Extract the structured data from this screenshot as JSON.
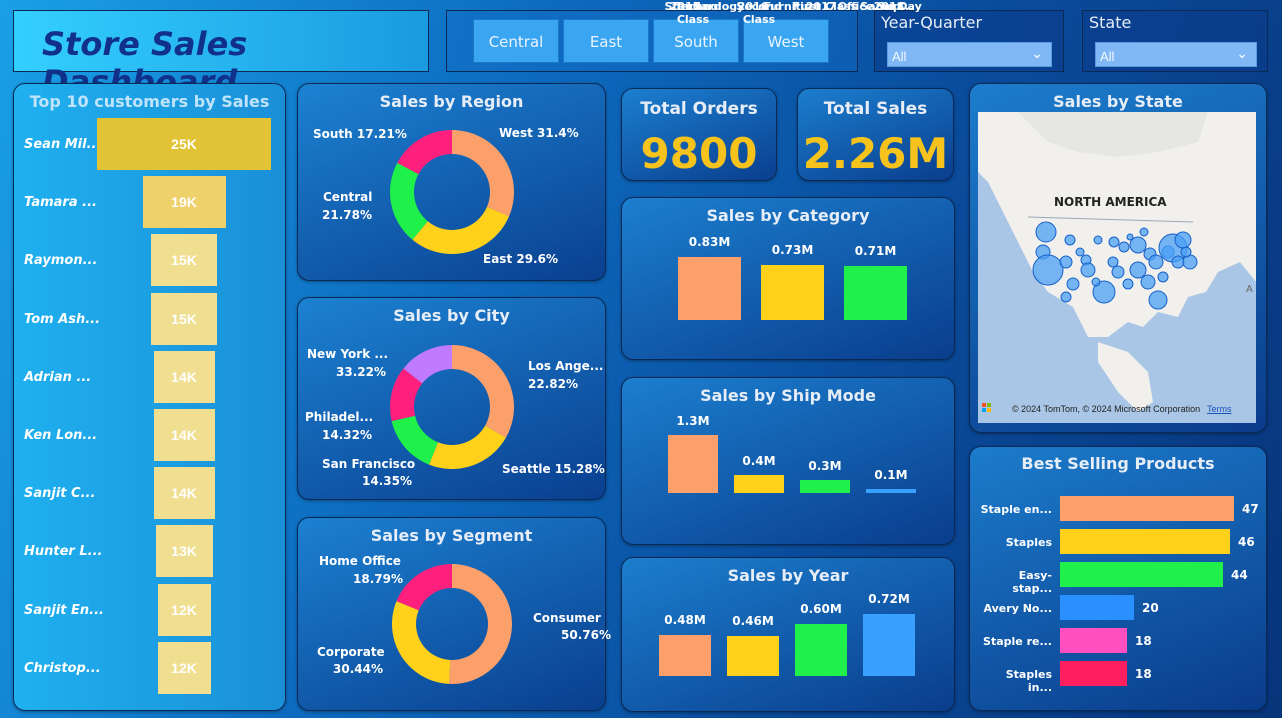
{
  "title": "Store Sales Dashboard",
  "regions": [
    "Central",
    "East",
    "South",
    "West"
  ],
  "slicers": {
    "year_quarter": {
      "label": "Year-Quarter",
      "value": "All"
    },
    "state": {
      "label": "State",
      "value": "All"
    }
  },
  "top_customers": {
    "title": "Top 10 customers by Sales",
    "names": [
      "Sean Mil...",
      "Tamara ...",
      "Raymon...",
      "Tom Ash...",
      "Adrian ...",
      "Ken Lon...",
      "Sanjit C...",
      "Hunter L...",
      "Sanjit En...",
      "Christop..."
    ],
    "labels": [
      "25K",
      "19K",
      "15K",
      "15K",
      "14K",
      "14K",
      "14K",
      "13K",
      "12K",
      "12K"
    ]
  },
  "kpis": {
    "orders_label": "Total Orders",
    "orders_value": "9800",
    "sales_label": "Total Sales",
    "sales_value": "2.26M"
  },
  "region_chart": {
    "title": "Sales by Region",
    "labels": [
      "West 31.4%",
      "East 29.6%",
      "Central",
      "21.78%",
      "South 17.21%"
    ]
  },
  "city_chart": {
    "title": "Sales by City",
    "labels": [
      "New York ...",
      "33.22%",
      "Los Ange...",
      "22.82%",
      "Philadel...",
      "14.32%",
      "San Francisco",
      "14.35%",
      "Seattle 15.28%"
    ]
  },
  "segment_chart": {
    "title": "Sales by Segment",
    "labels": [
      "Home Office",
      "18.79%",
      "Consumer",
      "50.76%",
      "Corporate",
      "30.44%"
    ]
  },
  "category_chart": {
    "title": "Sales by Category",
    "values": [
      "0.83M",
      "0.73M",
      "0.71M"
    ],
    "cats": [
      "Technology",
      "Furniture",
      "Office Sup..."
    ]
  },
  "shipmode_chart": {
    "title": "Sales by Ship Mode",
    "values": [
      "1.3M",
      "0.4M",
      "0.3M",
      "0.1M"
    ],
    "cats": [
      "Standard Class",
      "Second Class",
      "First Class",
      "Same Day"
    ]
  },
  "year_chart": {
    "title": "Sales by Year",
    "values": [
      "0.48M",
      "0.46M",
      "0.60M",
      "0.72M"
    ],
    "cats": [
      "2015",
      "2016",
      "2017",
      "2018"
    ]
  },
  "state_map": {
    "title": "Sales by State",
    "region_label": "NORTH AMERICA",
    "copyright": "© 2024 TomTom, © 2024 Microsoft Corporation",
    "terms": "Terms"
  },
  "products": {
    "title": "Best Selling Products",
    "names": [
      "Staple en...",
      "Staples",
      "Easy-stap...",
      "Avery No...",
      "Staple re...",
      "Staples in..."
    ],
    "values": [
      "47",
      "46",
      "44",
      "20",
      "18",
      "18"
    ]
  },
  "chart_data": [
    {
      "type": "bar",
      "title": "Top 10 customers by Sales",
      "categories": [
        "Sean Mil...",
        "Tamara ...",
        "Raymon...",
        "Tom Ash...",
        "Adrian ...",
        "Ken Lon...",
        "Sanjit C...",
        "Hunter L...",
        "Sanjit En...",
        "Christop..."
      ],
      "values": [
        25,
        19,
        15,
        15,
        14,
        14,
        14,
        13,
        12,
        12
      ]
    },
    {
      "type": "pie",
      "title": "Sales by Region",
      "categories": [
        "West",
        "East",
        "Central",
        "South"
      ],
      "values": [
        31.4,
        29.6,
        21.78,
        17.21
      ],
      "colors": [
        "#fba06b",
        "#ffd11a",
        "#1ff14a",
        "#ff1f7d"
      ]
    },
    {
      "type": "pie",
      "title": "Sales by City",
      "categories": [
        "New York ...",
        "Los Ange...",
        "Seattle",
        "San Francisco",
        "Philadel..."
      ],
      "values": [
        33.22,
        22.82,
        15.28,
        14.35,
        14.32
      ],
      "colors": [
        "#fba06b",
        "#ffd11a",
        "#1ff14a",
        "#ff1f7d",
        "#c07aff"
      ]
    },
    {
      "type": "pie",
      "title": "Sales by Segment",
      "categories": [
        "Consumer",
        "Corporate",
        "Home Office"
      ],
      "values": [
        50.76,
        30.44,
        18.79
      ],
      "colors": [
        "#fba06b",
        "#ffd11a",
        "#ff1f7d"
      ]
    },
    {
      "type": "bar",
      "title": "Sales by Category",
      "categories": [
        "Technology",
        "Furniture",
        "Office Sup..."
      ],
      "values": [
        0.83,
        0.73,
        0.71
      ]
    },
    {
      "type": "bar",
      "title": "Sales by Ship Mode",
      "categories": [
        "Standard Class",
        "Second Class",
        "First Class",
        "Same Day"
      ],
      "values": [
        1.3,
        0.4,
        0.3,
        0.1
      ]
    },
    {
      "type": "bar",
      "title": "Sales by Year",
      "categories": [
        "2015",
        "2016",
        "2017",
        "2018"
      ],
      "values": [
        0.48,
        0.46,
        0.6,
        0.72
      ]
    },
    {
      "type": "bar",
      "title": "Best Selling Products",
      "categories": [
        "Staple en...",
        "Staples",
        "Easy-stap...",
        "Avery No...",
        "Staple re...",
        "Staples in..."
      ],
      "values": [
        47,
        46,
        44,
        20,
        18,
        18
      ]
    }
  ]
}
